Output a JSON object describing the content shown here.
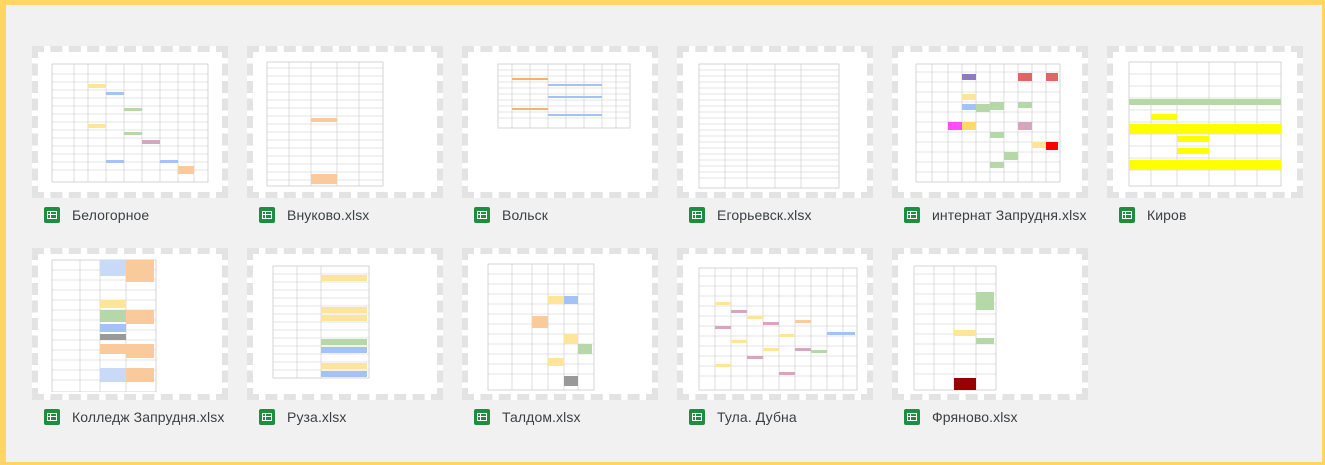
{
  "files": [
    {
      "name": "Белогорное",
      "icon": "google-sheets-icon"
    },
    {
      "name": "Внуково.xlsx",
      "icon": "google-sheets-icon"
    },
    {
      "name": "Вольск",
      "icon": "google-sheets-icon"
    },
    {
      "name": "Егорьевск.xlsx",
      "icon": "google-sheets-icon"
    },
    {
      "name": "интернат Запрудня.xlsx",
      "icon": "google-sheets-icon"
    },
    {
      "name": "Киров",
      "icon": "google-sheets-icon"
    },
    {
      "name": "Колледж Запрудня.xlsx",
      "icon": "google-sheets-icon"
    },
    {
      "name": "Руза.xlsx",
      "icon": "google-sheets-icon"
    },
    {
      "name": "Талдом.xlsx",
      "icon": "google-sheets-icon"
    },
    {
      "name": "Тула. Дубна",
      "icon": "google-sheets-icon"
    },
    {
      "name": "Фряново.xlsx",
      "icon": "google-sheets-icon"
    }
  ],
  "colors": {
    "highlight_border": "#fdd663",
    "background": "#f1f1f1",
    "sheets_green": "#1e8e3e",
    "cell_orange": "#f9cb9c",
    "cell_yellow": "#ffe599",
    "cell_green": "#b6d7a8",
    "cell_blue": "#a4c2f4",
    "cell_purple": "#d5a6bd",
    "cell_red": "#e06666",
    "cell_bright_yellow": "#ffff00"
  }
}
